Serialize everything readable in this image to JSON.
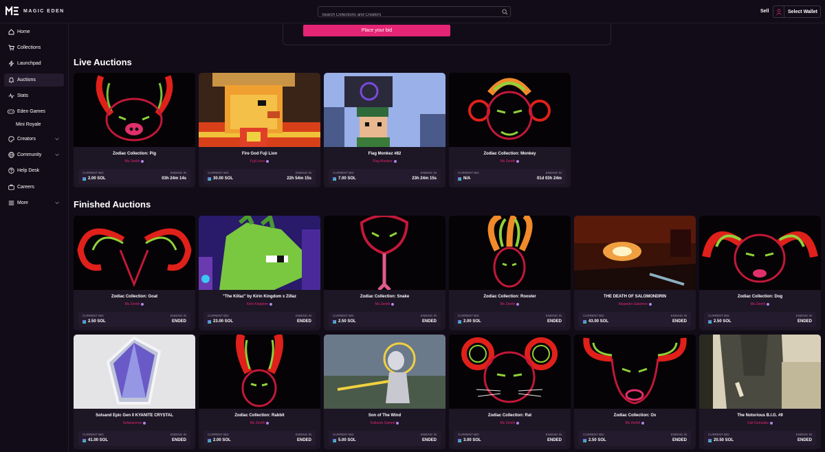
{
  "brand": {
    "name": "MAGIC EDEN"
  },
  "search": {
    "placeholder": "Search Collections and Creators"
  },
  "header": {
    "sell_label": "Sell",
    "wallet_label": "Select Wallet"
  },
  "sidebar": {
    "items": [
      {
        "label": "Home",
        "icon": "home-icon"
      },
      {
        "label": "Collections",
        "icon": "cart-icon"
      },
      {
        "label": "Launchpad",
        "icon": "bolt-icon"
      },
      {
        "label": "Auctions",
        "icon": "bell-icon",
        "active": true
      },
      {
        "label": "Stats",
        "icon": "stats-icon"
      },
      {
        "label": "Eden Games",
        "icon": "gamepad-icon"
      },
      {
        "label": "Mini Royale",
        "sub": true
      },
      {
        "label": "Creators",
        "icon": "palette-icon",
        "expandable": true
      },
      {
        "label": "Community",
        "icon": "globe-icon",
        "expandable": true
      },
      {
        "label": "Help Desk",
        "icon": "help-icon"
      },
      {
        "label": "Careers",
        "icon": "briefcase-icon"
      },
      {
        "label": "More",
        "icon": "menu-icon",
        "expandable": true
      }
    ]
  },
  "bid_button_label": "Place your bid",
  "labels": {
    "current_bid": "CURRENT BID",
    "ending_in": "ENDING IN"
  },
  "live": {
    "title": "Live Auctions",
    "cards": [
      {
        "name": "Zodiac Collection: Pig",
        "creator": "Ms Zenith",
        "bid": "2.00 SOL",
        "ending": "03h 24m 14s"
      },
      {
        "name": "Fire God Fuji Lion",
        "creator": "Fuji Lions",
        "bid": "30.00 SOL",
        "ending": "22h 54m 15s"
      },
      {
        "name": "Flag Monkez #82",
        "creator": "Flag Monkez",
        "bid": "7.00 SOL",
        "ending": "23h 24m 15s"
      },
      {
        "name": "Zodiac Collection: Monkey",
        "creator": "Ms Zenith",
        "bid": "N/A",
        "ending": "01d 03h 24m"
      }
    ]
  },
  "finished": {
    "title": "Finished Auctions",
    "cards": [
      {
        "name": "Zodiac Collection: Goat",
        "creator": "Ms Zenith",
        "bid": "2.50 SOL",
        "ending": "ENDED"
      },
      {
        "name": "\"The Killaz\" by Kirin Kingdom x Zillaz",
        "creator": "Kirin Kingdom",
        "bid": "23.00 SOL",
        "ending": "ENDED"
      },
      {
        "name": "Zodiac Collection: Snake",
        "creator": "Ms Zenith",
        "bid": "2.50 SOL",
        "ending": "ENDED"
      },
      {
        "name": "Zodiac Collection: Rooster",
        "creator": "Ms Zenith",
        "bid": "2.00 SOL",
        "ending": "ENDED"
      },
      {
        "name": "THE DEATH OF SALOMONDRIN",
        "creator": "Alejandro Salomon",
        "bid": "43.00 SOL",
        "ending": "ENDED"
      },
      {
        "name": "Zodiac Collection: Dog",
        "creator": "Ms Zenith",
        "bid": "2.50 SOL",
        "ending": "ENDED"
      },
      {
        "name": "Solsand Epic Gen 0 KYANITE CRYSTAL",
        "creator": "Solanaverse",
        "bid": "41.00 SOL",
        "ending": "ENDED"
      },
      {
        "name": "Zodiac Collection: Rabbit",
        "creator": "Ms Zenith",
        "bid": "2.00 SOL",
        "ending": "ENDED"
      },
      {
        "name": "Son of The Wind",
        "creator": "Kuburan Sampit",
        "bid": "5.00 SOL",
        "ending": "ENDED"
      },
      {
        "name": "Zodiac Collection: Rat",
        "creator": "Ms Zenith",
        "bid": "3.00 SOL",
        "ending": "ENDED"
      },
      {
        "name": "Zodiac Collection: Ox",
        "creator": "Ms Zenith",
        "bid": "2.50 SOL",
        "ending": "ENDED"
      },
      {
        "name": "The Notorious B.I.G. #9",
        "creator": "Cali Gonzalez",
        "bid": "20.50 SOL",
        "ending": "ENDED"
      }
    ]
  },
  "colors": {
    "accent": "#e42575",
    "background": "#120c18",
    "card": "#1c1625",
    "panel": "#241c2e"
  }
}
